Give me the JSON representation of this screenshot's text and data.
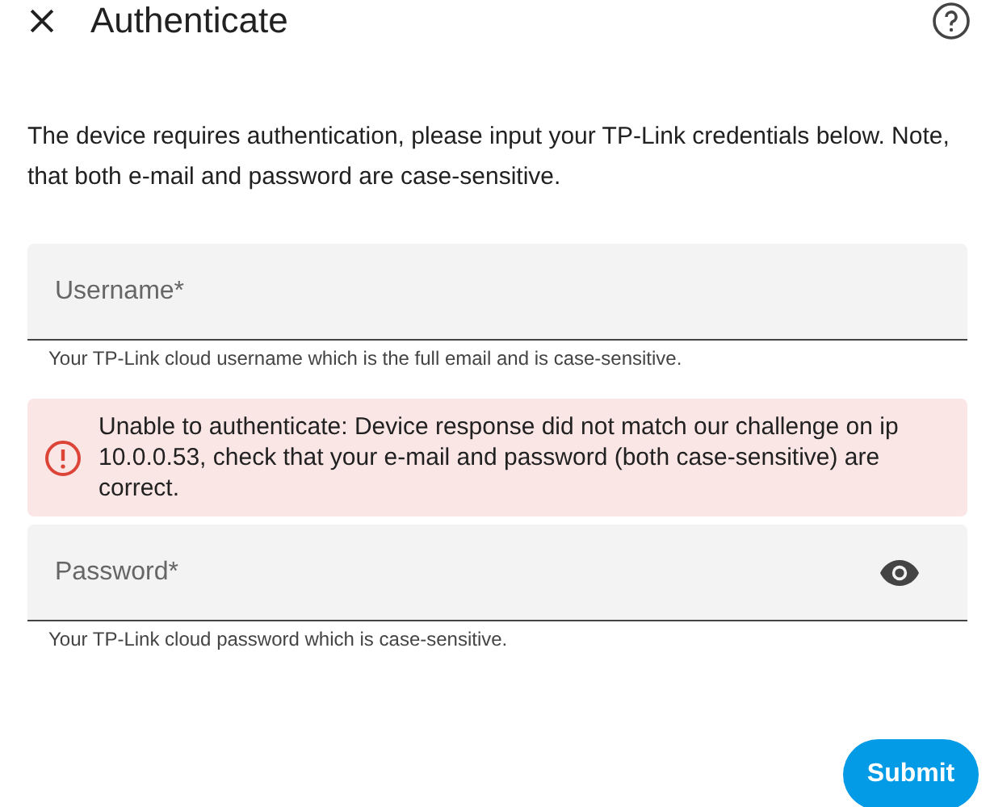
{
  "dialog": {
    "title": "Authenticate"
  },
  "description": "The device requires authentication, please input your TP-Link credentials below. Note, that both e-mail and password are case-sensitive.",
  "fields": [
    {
      "kind": "text",
      "placeholder": "Username*",
      "helper": "Your TP-Link cloud username which is the full email and is case-sensitive."
    },
    {
      "kind": "error",
      "message": "Unable to authenticate: Device response did not match our challenge on ip 10.0.0.53, check that your e-mail and password (both case-sensitive) are correct."
    },
    {
      "kind": "password",
      "placeholder": "Password*",
      "helper": "Your TP-Link cloud password which is case-sensitive."
    }
  ],
  "submit_button": "Submit"
}
